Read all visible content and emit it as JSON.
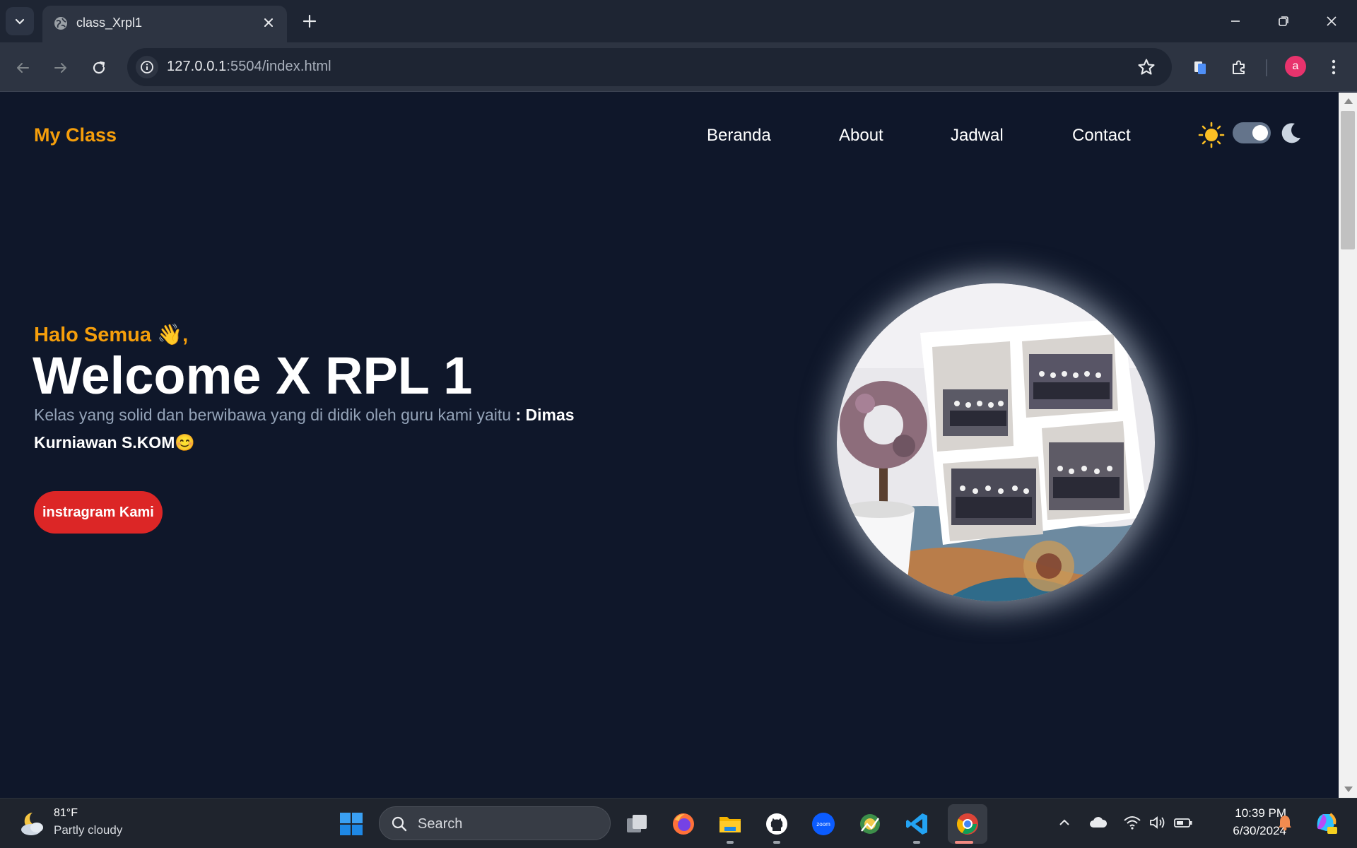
{
  "browser": {
    "tab_title": "class_Xrpl1",
    "url_host": "127.0.0.1",
    "url_rest": ":5504/index.html",
    "profile_initial": "a"
  },
  "nav": {
    "brand": "My Class",
    "links": [
      "Beranda",
      "About",
      "Jadwal",
      "Contact"
    ],
    "theme_toggle_dark": true
  },
  "hero": {
    "greeting": "Halo Semua",
    "greeting_emoji": "👋",
    "greeting_comma": ",",
    "title": "Welcome X RPL 1",
    "description": "Kelas yang solid dan berwibawa yang di didik oleh guru kami yaitu",
    "teacher": ": Dimas Kurniawan S.KOM",
    "teacher_emoji": "😊",
    "cta_label": "instragram Kami"
  },
  "taskbar": {
    "temperature": "81°F",
    "weather": "Partly cloudy",
    "search_label": "Search",
    "time": "10:39 PM",
    "date": "6/30/2024"
  },
  "colors": {
    "page_bg": "#0f172a",
    "accent": "#f59e0b",
    "cta": "#dc2626",
    "muted_text": "#94a3b8"
  }
}
